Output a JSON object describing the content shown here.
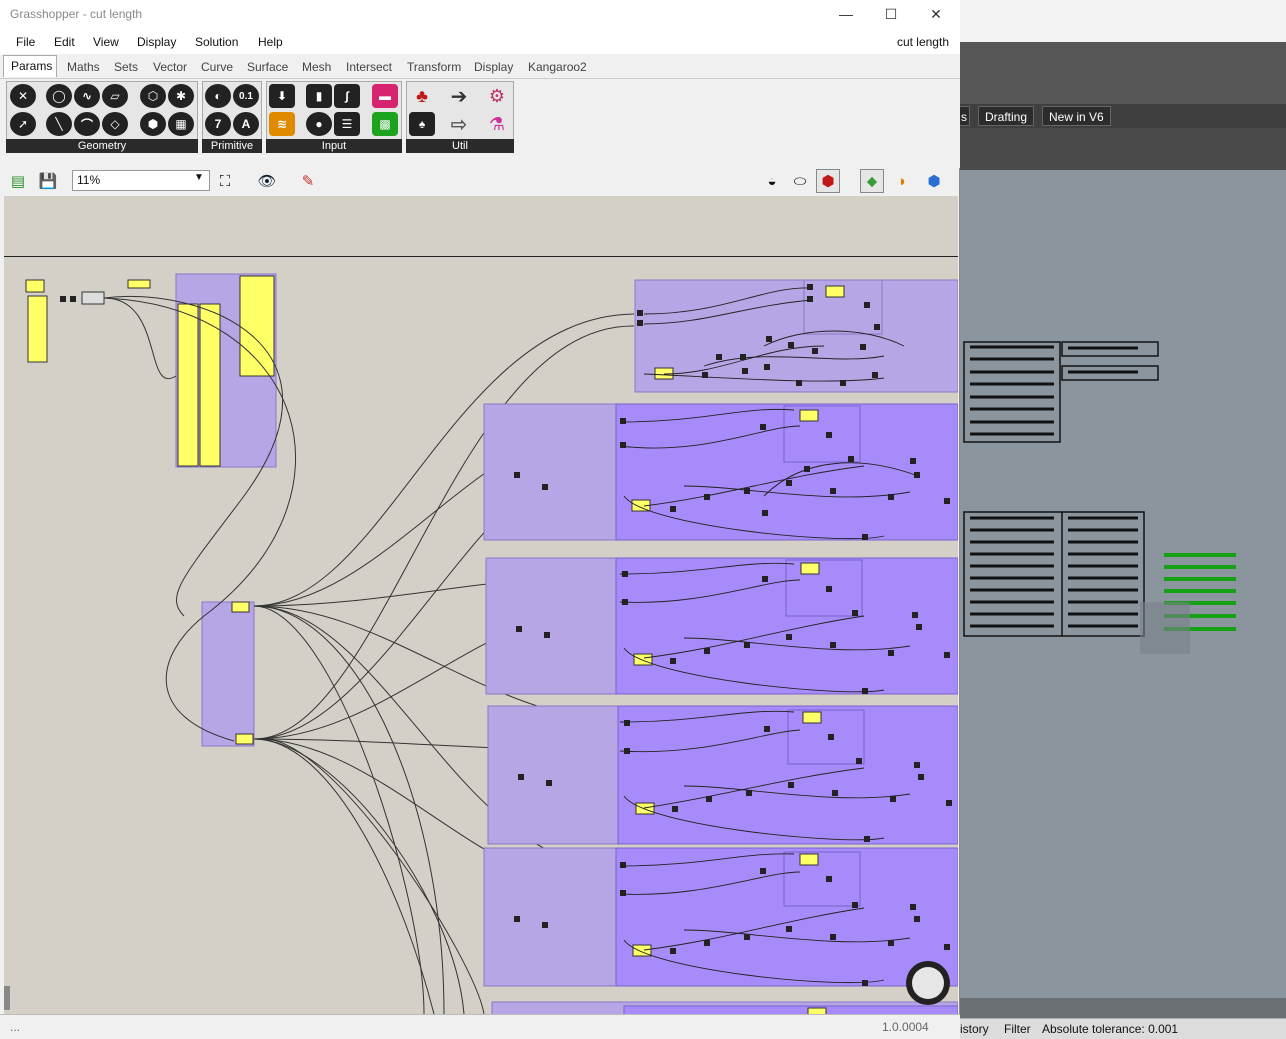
{
  "window": {
    "title": "Grasshopper - cut length",
    "document_name": "cut length",
    "minimize": "—",
    "maximize": "☐",
    "close": "✕"
  },
  "menu": [
    "File",
    "Edit",
    "View",
    "Display",
    "Solution",
    "Help"
  ],
  "tabs": [
    "Params",
    "Maths",
    "Sets",
    "Vector",
    "Curve",
    "Surface",
    "Mesh",
    "Intersect",
    "Transform",
    "Display",
    "Kangaroo2"
  ],
  "ribbon_groups": [
    "Geometry",
    "Primitive",
    "Input",
    "Util"
  ],
  "ribbon_glyphs": {
    "primitive_number": "0.1",
    "primitive_integer": "7",
    "primitive_text": "A"
  },
  "canvas_toolbar": {
    "zoom": "11%"
  },
  "status": {
    "left": "...",
    "version": "1.0.0004"
  },
  "rhino": {
    "tabs": [
      "s",
      "Drafting",
      "New in V6"
    ],
    "status_items": [
      "istory",
      "Filter",
      "Absolute tolerance: 0.001"
    ]
  },
  "colors": {
    "group_purple": "#a78bfa",
    "group_light": "#b7a6e6",
    "panel_yellow": "#ffff66",
    "canvas_bg": "#d4d0c8",
    "preview_green": "#16a016"
  },
  "icons": {
    "open": "open-file-icon",
    "save": "save-file-icon",
    "zoom_extents": "zoom-extents-icon",
    "preview": "eye-icon",
    "sketch": "pen-icon"
  }
}
